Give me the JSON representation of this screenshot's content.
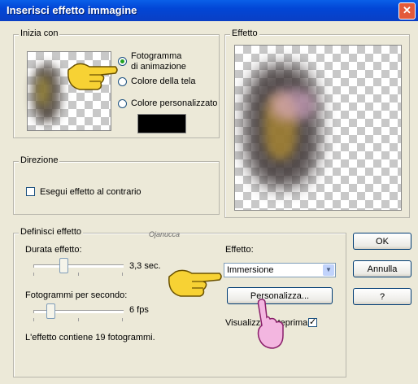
{
  "window": {
    "title": "Inserisci effetto immagine",
    "close_glyph": "✕"
  },
  "start_group": {
    "legend": "Inizia con",
    "options": [
      {
        "label": "Fotogramma\ndi animazione",
        "line1": "Fotogramma",
        "line2": "di animazione",
        "selected": true
      },
      {
        "label": "Colore della tela",
        "selected": false
      },
      {
        "label": "Colore personalizzato",
        "selected": false
      }
    ],
    "custom_color": "#000000"
  },
  "preview_group": {
    "legend": "Effetto"
  },
  "direction_group": {
    "legend": "Direzione",
    "reverse_label": "Esegui effetto al contrario",
    "reverse_checked": false
  },
  "define_group": {
    "legend": "Definisci effetto",
    "duration_label": "Durata effetto:",
    "duration_value": "3,3 sec.",
    "duration_fraction": 0.33,
    "fps_label": "Fotogrammi per secondo:",
    "fps_value": "6 fps",
    "fps_fraction": 0.2,
    "frames_info": "L'effetto contiene 19 fotogrammi.",
    "effect_label": "Effetto:",
    "effect_selected": "Immersione",
    "customize_button": "Personalizza...",
    "preview_label": "Visualizza anteprima",
    "preview_checked": true,
    "watermark": "Ojanucca"
  },
  "buttons": {
    "ok": "OK",
    "cancel": "Annulla",
    "help": "?"
  },
  "icons": [
    "close-icon",
    "pointing-hand-icon",
    "radio-icon",
    "checkbox-icon",
    "dropdown-arrow-icon"
  ]
}
